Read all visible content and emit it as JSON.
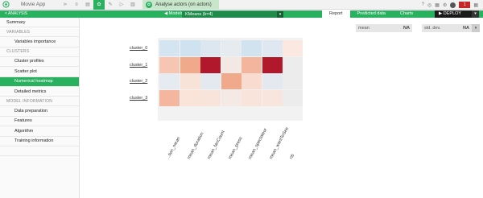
{
  "topbar": {
    "app_name": "Movie App",
    "analysis_tab": "Analyse actors (on actors)",
    "notification_count": "1",
    "icons": [
      "flow-icon",
      "database-icon",
      "recipe-icon",
      "analysis-icon",
      "notebook-icon",
      "dashboard-icon",
      "chart-icon"
    ]
  },
  "nav": {
    "back_label": "< ANALYSIS",
    "models_label": "◀ Models",
    "model_name": "KMeans (k=4)",
    "tabs": [
      "Report",
      "Predicted data",
      "Charts"
    ],
    "deploy_label": "▶ DEPLOY"
  },
  "sidebar": {
    "summary": "Summary",
    "variables_header": "VARIABLES",
    "variables_importance": "Variables importance",
    "clusters_header": "CLUSTERS",
    "cluster_profiles": "Cluster profiles",
    "scatter_plot": "Scatter plot",
    "numerical_heatmap": "Numerical heatmap",
    "detailed_metrics": "Detailed metrics",
    "model_info_header": "MODEL INFORMATION",
    "data_preparation": "Data preparation",
    "features": "Features",
    "algorithm": "Algorithm",
    "training_information": "Training information"
  },
  "stats": {
    "mean_label": "mean",
    "mean_value": "NA",
    "std_label": "std. dev.",
    "std_value": "NA"
  },
  "colors": {
    "accent": "#2ab160",
    "accent_dark": "#1f8a4a"
  },
  "chart_data": {
    "type": "heatmap",
    "rows": [
      "cluster_0",
      "cluster_1",
      "cluster_2",
      "cluster_3"
    ],
    "columns": [
      "...tion_mean",
      "mean_duration",
      "mean_fanCount",
      "mean_press",
      "mean_spectateur",
      "mean_wantToSee",
      "nb"
    ],
    "colors": [
      [
        "#d4e4f1",
        "#cfe2f0",
        "#dde7ef",
        "#e6ebef",
        "#d2e3f0",
        "#dfe8f0",
        "#fbe9e1"
      ],
      [
        "#f7c6b2",
        "#f1a98c",
        "#b2182b",
        "#f4e8e4",
        "#f3b59d",
        "#b2182b",
        "#ececec"
      ],
      [
        "#e5ebf0",
        "#f9e2d7",
        "#e3e9ef",
        "#f1a98c",
        "#f9dccf",
        "#e3e9ef",
        "#ececec"
      ],
      [
        "#f4b69e",
        "#fae4da",
        "#f9e4db",
        "#f5e9e5",
        "#f9e4db",
        "#f7e5de",
        "#ececec"
      ]
    ]
  }
}
